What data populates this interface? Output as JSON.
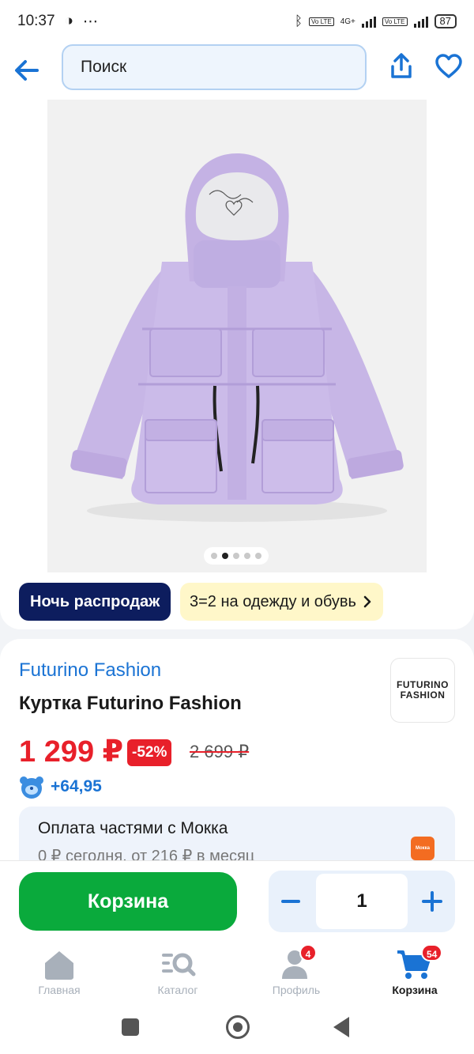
{
  "status_bar": {
    "time": "10:37",
    "network": "4G+",
    "volte": "Vo LTE",
    "battery": "87"
  },
  "header": {
    "search_placeholder": "Поиск"
  },
  "gallery": {
    "image_count": 5,
    "active_index": 1,
    "promo_primary": "Ночь распродаж",
    "promo_secondary": "3=2 на одежду и обувь"
  },
  "product": {
    "brand": "Futurino Fashion",
    "title": "Куртка Futurino Fashion",
    "brand_logo_line1": "FUTURINO",
    "brand_logo_line2": "FASHION",
    "price": "1 299 ₽",
    "discount": "-52%",
    "old_price": "2 699 ₽",
    "bonus": "+64,95",
    "installment_title": "Оплата частями с Мокка",
    "installment_sub": "0 ₽ сегодня, от 216 ₽ в месяц",
    "installment_logo": "Мокка"
  },
  "actions": {
    "cart_label": "Корзина",
    "quantity": "1"
  },
  "bottom_nav": {
    "items": [
      {
        "label": "Главная"
      },
      {
        "label": "Каталог"
      },
      {
        "label": "Профиль",
        "badge": "4"
      },
      {
        "label": "Корзина",
        "badge": "54"
      }
    ],
    "active": "Корзина"
  },
  "colors": {
    "accent_blue": "#1a73d4",
    "price_red": "#e8202a",
    "cart_green": "#0aaa3c",
    "promo_dark": "#0d1d5e",
    "jacket_lavender": "#c9b8e8"
  }
}
